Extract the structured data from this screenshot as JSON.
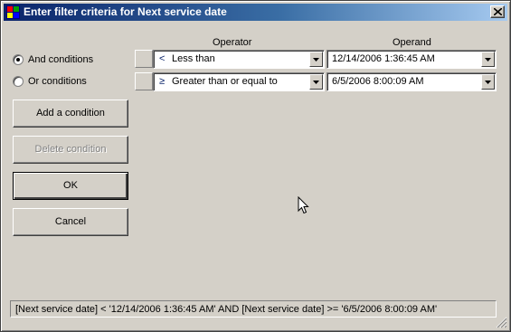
{
  "window": {
    "title": "Enter filter criteria for Next service date",
    "icon": "app-icon",
    "close_icon": "close-icon"
  },
  "conditions_mode": {
    "options": [
      {
        "label": "And conditions",
        "checked": true
      },
      {
        "label": "Or conditions",
        "checked": false
      }
    ]
  },
  "buttons": {
    "add": "Add a condition",
    "delete": "Delete condition",
    "ok": "OK",
    "cancel": "Cancel"
  },
  "grid": {
    "headers": {
      "operator": "Operator",
      "operand": "Operand"
    },
    "rows": [
      {
        "symbol": "<",
        "operator": "Less than",
        "operand": "12/14/2006 1:36:45 AM"
      },
      {
        "symbol": "≥",
        "operator": "Greater than or equal to",
        "operand": "6/5/2006 8:00:09 AM"
      }
    ]
  },
  "expression": "[Next service date] < '12/14/2006 1:36:45 AM' AND [Next service date] >= '6/5/2006 8:00:09 AM'"
}
